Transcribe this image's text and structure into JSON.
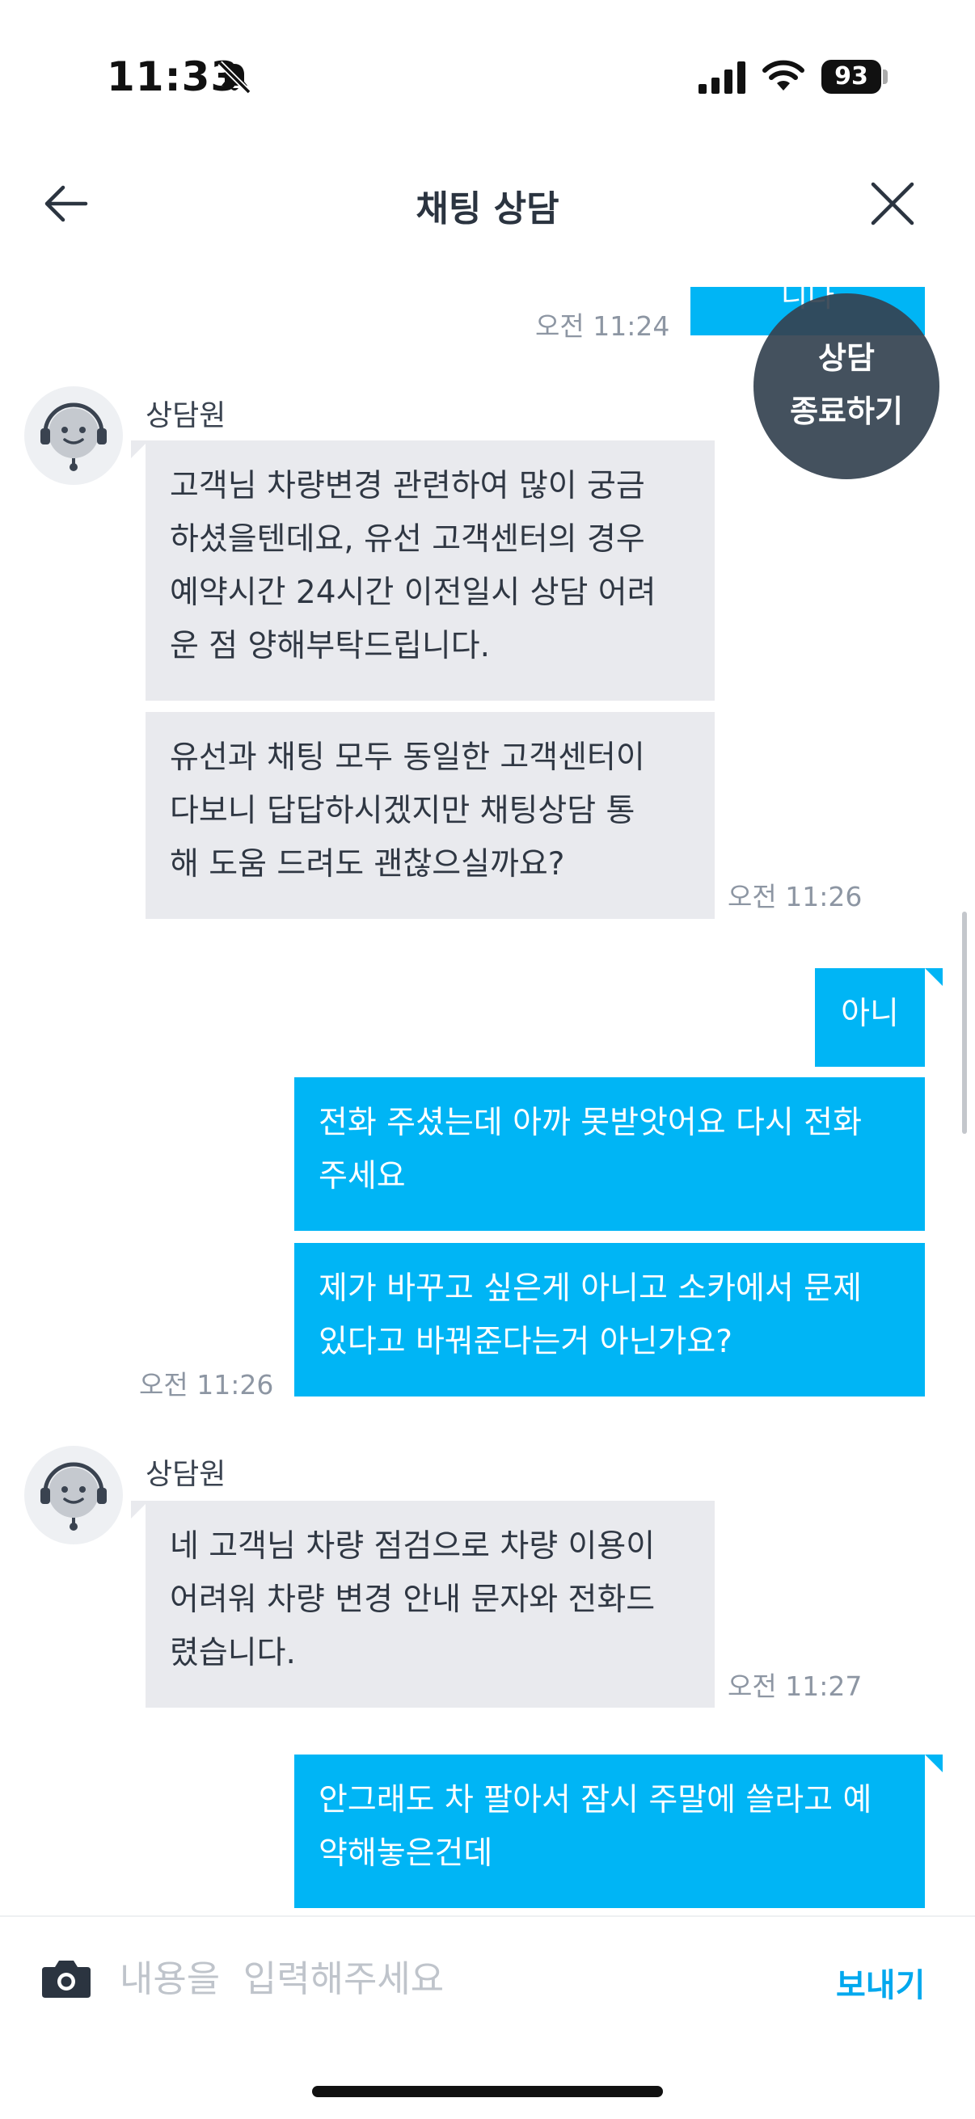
{
  "status_bar": {
    "time": "11:33",
    "battery": "93"
  },
  "header": {
    "title": "채팅 상담"
  },
  "end_button": {
    "line1": "상담",
    "line2": "종료하기"
  },
  "messages": {
    "m0": {
      "text": "접수해드리겠습니다",
      "time": "오전 11:24"
    },
    "g1": {
      "agent_name": "상담원",
      "b1": {
        "l1": "고객님 차량변경 관련하여 많이 궁금",
        "l2": "하셨을텐데요, 유선 고객센터의 경우",
        "l3": "예약시간 24시간 이전일시 상담 어려",
        "l4": "운 점 양해부탁드립니다."
      },
      "b2": {
        "l1": "유선과 채팅 모두 동일한 고객센터이",
        "l2": "다보니 답답하시겠지만 채팅상담 통",
        "l3": "해 도움 드려도 괜찮으실까요?"
      },
      "time": "오전 11:26"
    },
    "u1": {
      "b1": {
        "l1": "아니"
      },
      "b2": {
        "l1": "전화 주셨는데 아까 못받앗어요 다시 전화",
        "l2": "주세요"
      },
      "b3": {
        "l1": "제가 바꾸고 싶은게 아니고 소카에서 문제",
        "l2": "있다고 바꿔준다는거 아닌가요?"
      },
      "time": "오전 11:26"
    },
    "g2": {
      "agent_name": "상담원",
      "b1": {
        "l1": "네 고객님 차량 점검으로 차량 이용이",
        "l2": "어려워 차량 변경 안내 문자와 전화드",
        "l3": "렸습니다."
      },
      "time": "오전 11:27"
    },
    "u2": {
      "b1": {
        "l1": "안그래도 차 팔아서 잠시 주말에 쓸라고 예",
        "l2": "약해놓은건데"
      }
    }
  },
  "composer": {
    "placeholder": "내용을  입력해주세요",
    "send_label": "보내기"
  },
  "colors": {
    "user_bubble": "#00b5f5",
    "agent_bubble": "#e9eaee",
    "accent": "#00a8ee"
  }
}
